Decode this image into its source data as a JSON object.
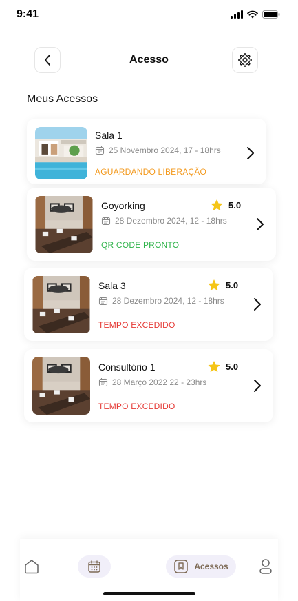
{
  "status_bar": {
    "time": "9:41"
  },
  "header": {
    "title": "Acesso"
  },
  "section_title": "Meus Acessos",
  "cards": [
    {
      "name": "Sala 1",
      "date": "25 Novembro 2024, 17 - 18hrs",
      "status": "AGUARDANDO LIBERAÇÃO",
      "status_color": "#f39a1f",
      "image": "pool-house-photo"
    },
    {
      "name": "Goyorking",
      "rating": "5.0",
      "date": "28 Dezembro 2024, 12 - 18hrs",
      "status": "QR CODE PRONTO",
      "status_color": "#2fb34a",
      "image": "meeting-room-photo"
    },
    {
      "name": "Sala 3",
      "rating": "5.0",
      "date": "28 Dezembro 2024, 12 - 18hrs",
      "status": "TEMPO EXCEDIDO",
      "status_color": "#e53935",
      "image": "meeting-room-photo"
    },
    {
      "name": "Consultório 1",
      "rating": "5.0",
      "date": "28 Março 2022 22 - 23hrs",
      "status": "TEMPO EXCEDIDO",
      "status_color": "#e53935",
      "image": "meeting-room-photo"
    }
  ],
  "bottom_nav": {
    "items": [
      {
        "icon": "home-icon"
      },
      {
        "icon": "calendar-icon"
      },
      {
        "icon": "bookmark-icon",
        "label": "Acessos",
        "active": true
      },
      {
        "icon": "profile-icon"
      }
    ]
  },
  "colors": {
    "accent": "#7d6a55",
    "pill_bg": "#f1eff9",
    "star": "#f5c518"
  }
}
